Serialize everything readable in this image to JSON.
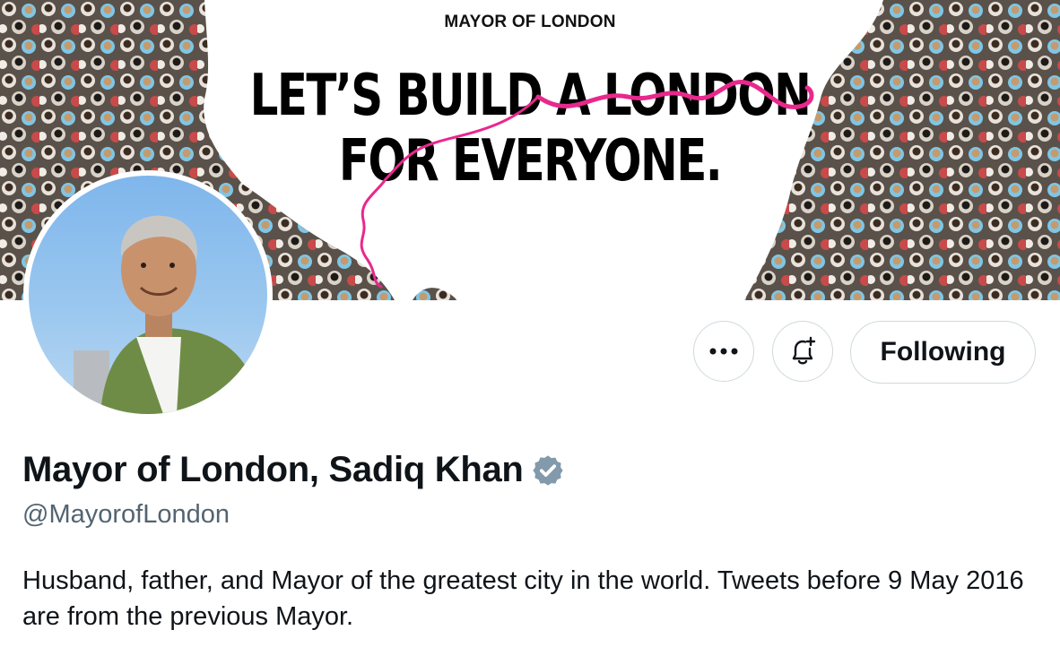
{
  "banner": {
    "brand": "MAYOR OF LONDON",
    "headline_line1": "LET’S BUILD A LONDON",
    "headline_line2": "FOR EVERYONE."
  },
  "profile": {
    "display_name": "Mayor of London, Sadiq Khan",
    "verified": true,
    "handle": "@MayorofLondon",
    "bio": "Husband, father, and Mayor of the greatest city in the world. Tweets before 9 May 2016 are from the previous Mayor."
  },
  "actions": {
    "more_icon": "ellipsis-icon",
    "notify_icon": "bell-plus-icon",
    "follow_label": "Following"
  },
  "colors": {
    "accent_pink": "#e8288c",
    "verified_badge": "#829aab",
    "text_primary": "#0f1419",
    "text_secondary": "#536471",
    "button_border": "#cfd9de"
  }
}
